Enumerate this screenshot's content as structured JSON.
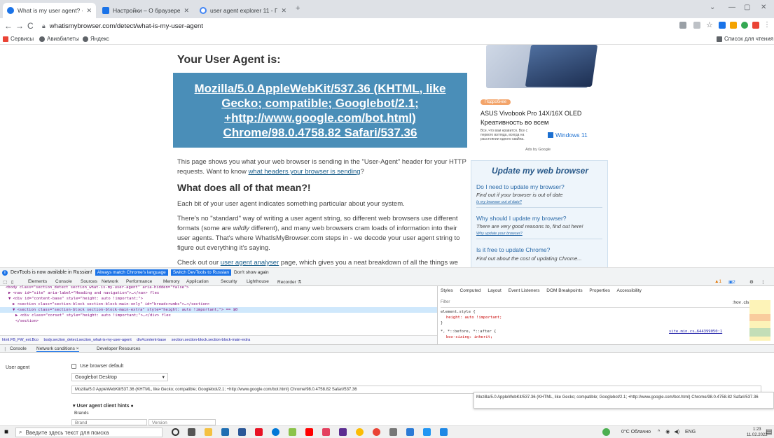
{
  "tabs": [
    {
      "title": "What is my user agent? - WhatIs",
      "active": true,
      "color": "#1a73e8"
    },
    {
      "title": "Настройки – О браузере Chrom",
      "active": false,
      "color": "#1a73e8"
    },
    {
      "title": "user agent explorer 11 - Поиск",
      "active": false,
      "color": "#4285f4"
    }
  ],
  "toolbar": {
    "url": "whatismybrowser.com/detect/what-is-my-user-agent"
  },
  "bookmarks": {
    "items": [
      "Сервисы",
      "Авиабилеты",
      "Яндекс"
    ],
    "reading_list": "Список для чтения"
  },
  "page": {
    "ua_heading": "Your User Agent is:",
    "ua_string": "Mozilla/5.0 AppleWebKit/537.36 (KHTML, like Gecko; compatible; Googlebot/2.1; +http://www.google.com/bot.html) Chrome/98.0.4758.82 Safari/537.36",
    "p1_text": "This page shows you what your web browser is sending in the \"User-Agent\" header for your HTTP requests. Want to know ",
    "p1_link": "what headers your browser is sending",
    "p1_end": "?",
    "h2": "What does all of that mean?!",
    "p2": "Each bit of your user agent indicates something particular about your system.",
    "p3_a": "There's no \"standard\" way of writing a user agent string, so different web browsers use different formats (some are ",
    "p3_em": "wildly",
    "p3_b": " different), and many web browsers cram loads of information into their user agents. That's where WhatIsMyBrowser.com steps in - we decode your user agent string to figure out everything it's saying.",
    "p4_a": "Check out our ",
    "p4_link": "user agent analyser",
    "p4_b": " page, which gives you a neat breakdown of all the things we"
  },
  "ad": {
    "tag": "Подробнее",
    "title": "ASUS Vivobook Pro 14X/16X OLED",
    "subtitle": "Креативность во всем",
    "small": "Все, что вам нравится. Все с первого взгляда, всегда на расстоянии одного свайпа.",
    "windows": "Windows 11",
    "ads_by": "Ads by Google"
  },
  "update": {
    "title": "Update my web browser",
    "items": [
      {
        "q": "Do I need to update my browser?",
        "a": "Find out if your browser is out of date",
        "link": "Is my browser out of date?"
      },
      {
        "q": "Why should I update my browser?",
        "a": "There are very good reasons to, find out here!",
        "link": "Why update your browser?"
      },
      {
        "q": "Is it free to update Chrome?",
        "a": "Find out about the cost of updating Chrome..."
      }
    ]
  },
  "banner": {
    "text": "DevTools is now available in Russian!",
    "btn1": "Always match Chrome's language",
    "btn2": "Switch DevTools to Russian",
    "btn3": "Don't show again"
  },
  "devtools": {
    "tabs": [
      "Elements",
      "Console",
      "Sources",
      "Network",
      "Performance",
      "Memory",
      "Application",
      "Security",
      "Lighthouse",
      "Recorder ⚗"
    ],
    "badges": [
      "▲1",
      "▣2"
    ],
    "code_lines": [
      "<body class=\"section_detect section_what-is-my-user-agent\" aria-hidden=\"false\">",
      "▶ <nav id=\"site\" aria-label=\"Heading and navigation\">…</nav> flex",
      "▼ <div id=\"content-base\" style=\"height: auto !important;\">",
      "▶ <section class=\"section-block section-block-main-only\" id=\"breadcrumbs\">…</section>",
      "▼ <section class=\"section-block section-block-main-extra\" style=\"height: auto !important;\"> == $0",
      "▶ <div class=\"corset\" style=\"height: auto !important;\">…</div> flex",
      "</section>"
    ],
    "crumbs": [
      "html.FB_FW_ext.Bco",
      "body.section_detect.section_what-is-my-user-agent",
      "div#content-base",
      "section.section-block.section-block-main-extra"
    ],
    "style_tabs": [
      "Styles",
      "Computed",
      "Layout",
      "Event Listeners",
      "DOM Breakpoints",
      "Properties",
      "Accessibility"
    ],
    "filter": "Filter",
    "filter_right": ":hov  .cls  +",
    "rule1": "element.style {",
    "rule1_prop": "height: auto !important;",
    "rule_end": "}",
    "rule2": "*, *::before, *::after {",
    "rule2_src": "site.min.cs…644399050:1",
    "rule2_prop": "box-sizing: inherit;"
  },
  "drawer": {
    "tabs": [
      "Console",
      "Network conditions ×",
      "Developer Resources"
    ],
    "ua_label": "User agent",
    "use_default": "Use browser default",
    "select_value": "Googlebot Desktop",
    "ua_value": "Mozilla/5.0 AppleWebKit/537.36 (KHTML, like Gecko; compatible; Googlebot/2.1; +http://www.google.com/bot.html) Chrome/98.0.4758.82 Safari/537.36",
    "tooltip": "Mozilla/5.0 AppleWebKit/537.36 (KHTML, like Gecko; compatible; Googlebot/2.1; +http://www.google.com/bot.html) Chrome/98.0.4758.82 Safari/537.36",
    "hints": "User agent client hints",
    "brands": "Brands",
    "brand_ph": "Brand",
    "version_ph": "Version"
  },
  "taskbar": {
    "search": "Введите здесь текст для поиска",
    "weather": "0°C Облачно",
    "lang": "ENG",
    "time": "1:23",
    "date": "11.02.2022"
  }
}
